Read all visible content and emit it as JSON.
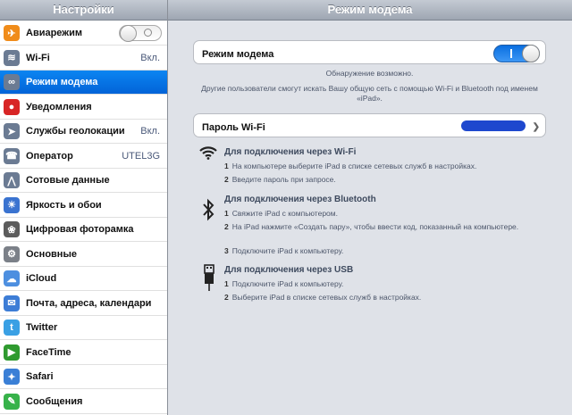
{
  "sidebar": {
    "title": "Настройки",
    "items": [
      {
        "label": "Авиарежим",
        "value": "",
        "icon": "airplane-icon",
        "color": "#f08c1a"
      },
      {
        "label": "Wi-Fi",
        "value": "Вкл.",
        "icon": "wifi-icon",
        "color": "#6b7b93"
      },
      {
        "label": "Режим модема",
        "value": "",
        "icon": "personal-hotspot-icon",
        "color": "#6b7b93"
      },
      {
        "label": "Уведомления",
        "value": "",
        "icon": "notifications-icon",
        "color": "#d82525"
      },
      {
        "label": "Службы геолокации",
        "value": "Вкл.",
        "icon": "location-icon",
        "color": "#6b7b93"
      },
      {
        "label": "Оператор",
        "value": "UTEL3G",
        "icon": "phone-icon",
        "color": "#6b7b93"
      },
      {
        "label": "Сотовые данные",
        "value": "",
        "icon": "cellular-icon",
        "color": "#6b7b93"
      },
      {
        "label": "Яркость и обои",
        "value": "",
        "icon": "brightness-icon",
        "color": "#3a73d0"
      },
      {
        "label": "Цифровая фоторамка",
        "value": "",
        "icon": "photo-frame-icon",
        "color": "#5c5c5c"
      },
      {
        "label": "Основные",
        "value": "",
        "icon": "general-gear-icon",
        "color": "#7b8088"
      },
      {
        "label": "iCloud",
        "value": "",
        "icon": "icloud-icon",
        "color": "#4d8fe0"
      },
      {
        "label": "Почта, адреса, календари",
        "value": "",
        "icon": "mail-icon",
        "color": "#3d7dd6"
      },
      {
        "label": "Twitter",
        "value": "",
        "icon": "twitter-icon",
        "color": "#3aa0e4"
      },
      {
        "label": "FaceTime",
        "value": "",
        "icon": "facetime-icon",
        "color": "#2f9a2f"
      },
      {
        "label": "Safari",
        "value": "",
        "icon": "safari-icon",
        "color": "#3a7fd6"
      },
      {
        "label": "Сообщения",
        "value": "",
        "icon": "messages-icon",
        "color": "#37b24a"
      }
    ]
  },
  "main": {
    "title": "Режим модема",
    "hotspot_label": "Режим модема",
    "hotspot_state": "on",
    "discoverable": "Обнаружение возможно.",
    "info": "Другие пользователи смогут искать Вашу общую сеть с помощью Wi-Fi и Bluetooth под именем «iPad».",
    "password_label": "Пароль Wi-Fi",
    "sections": [
      {
        "title": "Для подключения через Wi-Fi",
        "icon": "wifi-icon",
        "steps": [
          {
            "n": "1",
            "text": "На компьютере выберите iPad в списке сетевых служб в настройках."
          },
          {
            "n": "2",
            "text": "Введите пароль при запросе."
          }
        ]
      },
      {
        "title": "Для подключения через Bluetooth",
        "icon": "bluetooth-icon",
        "steps": [
          {
            "n": "1",
            "text": "Свяжите iPad с компьютером."
          },
          {
            "n": "2",
            "text": "На iPad нажмите «Создать пару», чтобы ввести код, показанный на компьютере."
          },
          {
            "n": "3",
            "text": "Подключите iPad к компьютеру."
          }
        ]
      },
      {
        "title": "Для подключения через USB",
        "icon": "usb-icon",
        "steps": [
          {
            "n": "1",
            "text": "Подключите iPad к компьютеру."
          },
          {
            "n": "2",
            "text": "Выберите iPad в списке сетевых служб в настройках."
          }
        ]
      }
    ]
  }
}
